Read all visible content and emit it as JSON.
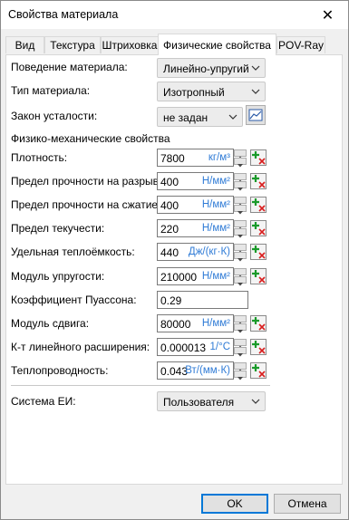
{
  "window": {
    "title": "Свойства материала",
    "close_glyph": "✕"
  },
  "tabs": [
    {
      "label": "Вид"
    },
    {
      "label": "Текстура"
    },
    {
      "label": "Штриховка"
    },
    {
      "label": "Физические свойства",
      "active": true
    },
    {
      "label": "POV-Ray"
    }
  ],
  "general": {
    "behavior": {
      "label": "Поведение материала:",
      "value": "Линейно-упругий"
    },
    "type": {
      "label": "Тип материала:",
      "value": "Изотропный"
    },
    "fatigue": {
      "label": "Закон усталости:",
      "value": "не задан",
      "button_icon": "chart-icon"
    }
  },
  "section_title": "Физико-механические свойства",
  "properties": [
    {
      "label": "Плотность:",
      "value": "7800",
      "unit": "кг/м³",
      "spinner": true,
      "calc_button": true
    },
    {
      "label": "Предел прочности на разрыв:",
      "value": "400",
      "unit": "Н/мм²",
      "spinner": true,
      "calc_button": true
    },
    {
      "label": "Предел прочности на сжатие:",
      "value": "400",
      "unit": "Н/мм²",
      "spinner": true,
      "calc_button": true
    },
    {
      "label": "Предел текучести:",
      "value": "220",
      "unit": "Н/мм²",
      "spinner": true,
      "calc_button": true
    },
    {
      "label": "Удельная теплоёмкость:",
      "value": "440",
      "unit": "Дж/(кг·К)",
      "spinner": true,
      "calc_button": true
    },
    {
      "label": "Модуль упругости:",
      "value": "210000",
      "unit": "Н/мм²",
      "spinner": true,
      "calc_button": true
    },
    {
      "label": "Коэффициент Пуассона:",
      "value": "0.29",
      "unit": "",
      "spinner": false,
      "calc_button": false
    },
    {
      "label": "Модуль сдвига:",
      "value": "80000",
      "unit": "Н/мм²",
      "spinner": true,
      "calc_button": true
    },
    {
      "label": "К-т линейного расширения:",
      "value": "0.000013",
      "unit": "1/°С",
      "spinner": true,
      "calc_button": true
    },
    {
      "label": "Теплопроводность:",
      "value": "0.043",
      "unit": "Вт/(мм·К)",
      "spinner": true,
      "calc_button": true
    }
  ],
  "units_system": {
    "label": "Система ЕИ:",
    "value": "Пользователя"
  },
  "footer": {
    "ok_label": "OK",
    "cancel_label": "Отмена"
  },
  "colors": {
    "unit_text": "#2f7bd6",
    "calc_icon_green": "#1a9a2a",
    "calc_icon_red": "#d81e1e",
    "primary_border": "#0078d7"
  }
}
